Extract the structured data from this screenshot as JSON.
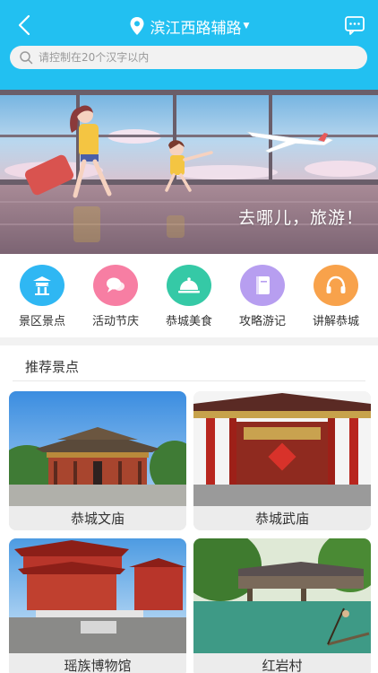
{
  "header": {
    "location": "滨江西路辅路",
    "search_placeholder": "请控制在20个汉字以内",
    "bg_color": "#22c0f1"
  },
  "banner": {
    "slogan": "去哪儿，旅游！"
  },
  "categories": [
    {
      "label": "景区景点",
      "icon": "temple-icon",
      "color": "#2fb7f3"
    },
    {
      "label": "活动节庆",
      "icon": "chat-bubble-icon",
      "color": "#f77ea3"
    },
    {
      "label": "恭城美食",
      "icon": "food-cloche-icon",
      "color": "#35c9a6"
    },
    {
      "label": "攻略游记",
      "icon": "book-icon",
      "color": "#b79ef0"
    },
    {
      "label": "讲解恭城",
      "icon": "headphones-icon",
      "color": "#f8a24b"
    }
  ],
  "recommend": {
    "title": "推荐景点",
    "items": [
      {
        "name": "恭城文庙"
      },
      {
        "name": "恭城武庙"
      },
      {
        "name": "瑶族博物馆"
      },
      {
        "name": "红岩村"
      }
    ]
  }
}
